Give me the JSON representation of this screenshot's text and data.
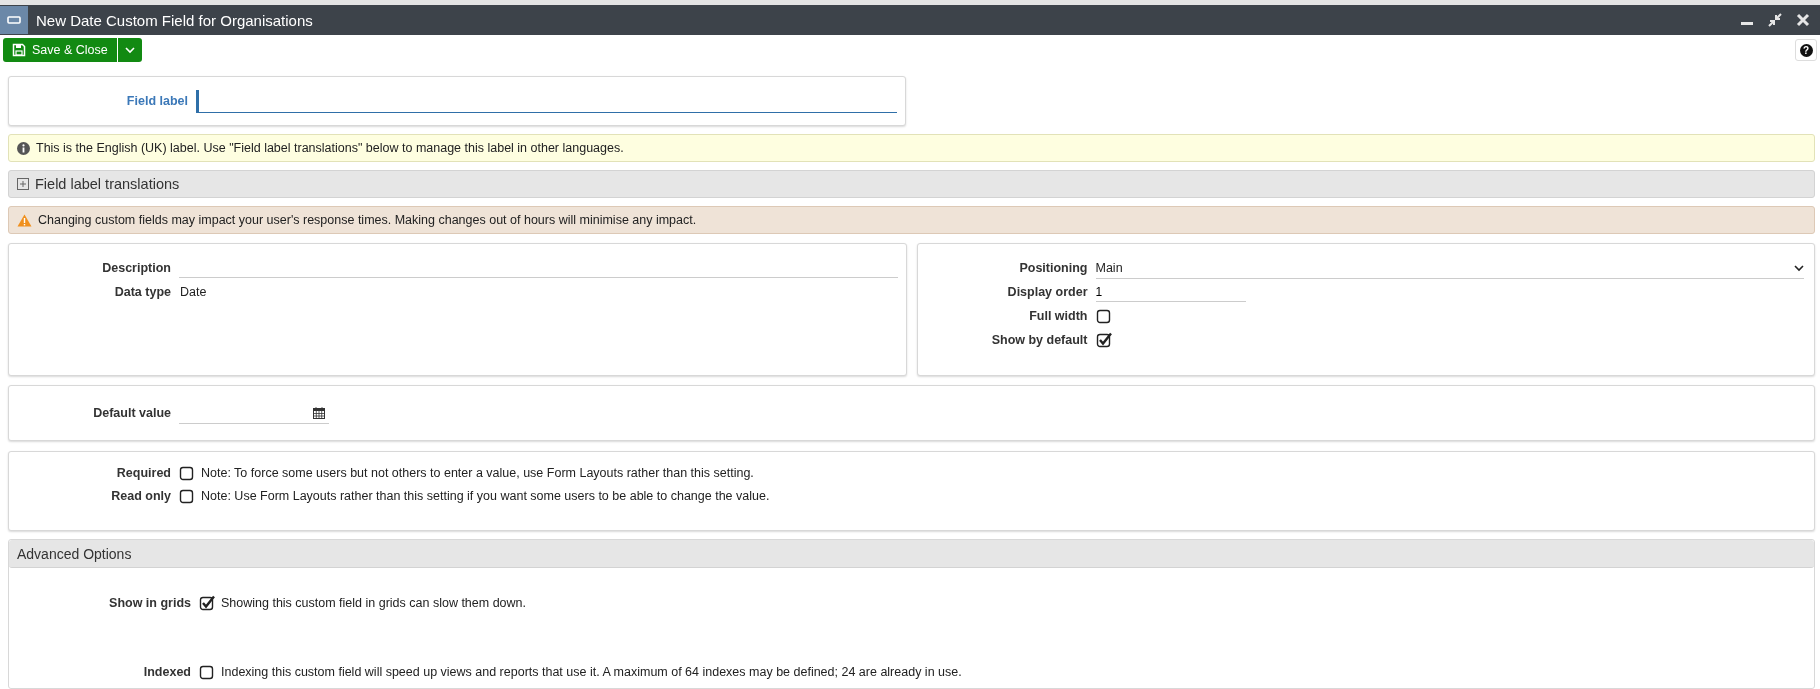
{
  "window": {
    "title": "New Date Custom Field for Organisations"
  },
  "toolbar": {
    "save_button": "Save & Close",
    "help_button": "?"
  },
  "field_label": {
    "label": "Field label"
  },
  "info_message": "This is the English (UK) label. Use \"Field label translations\" below to manage this label in other languages.",
  "translations_section": {
    "title": "Field label translations",
    "expanded": false
  },
  "warning_message": "Changing custom fields may impact your user's response times. Making changes out of hours will minimise any impact.",
  "details": [
    {
      "kind": "input",
      "label": "Description"
    },
    {
      "kind": "text",
      "label": "Data type",
      "value": "Date"
    }
  ],
  "display": [
    {
      "kind": "select",
      "label": "Positioning",
      "value": "Main"
    },
    {
      "kind": "input",
      "label": "Display order",
      "value": "1"
    },
    {
      "kind": "checkbox",
      "label": "Full width",
      "checked": false
    },
    {
      "kind": "checkbox",
      "label": "Show by default",
      "checked": true
    }
  ],
  "default_value": {
    "label": "Default value"
  },
  "constraints": [
    {
      "label": "Required",
      "checked": false,
      "note": "Note: To force some users but not others to enter a value, use Form Layouts rather than this setting."
    },
    {
      "label": "Read only",
      "checked": false,
      "note": "Note: Use Form Layouts rather than this setting if you want some users to be able to change the value."
    }
  ],
  "advanced": {
    "title": "Advanced Options",
    "items": [
      {
        "label": "Show in grids",
        "checked": true,
        "note": "Showing this custom field in grids can slow them down."
      },
      {
        "label": "Indexed",
        "checked": false,
        "note": "Indexing this custom field will speed up views and reports that use it. A maximum of 64 indexes may be defined; 24 are already in use."
      }
    ]
  }
}
